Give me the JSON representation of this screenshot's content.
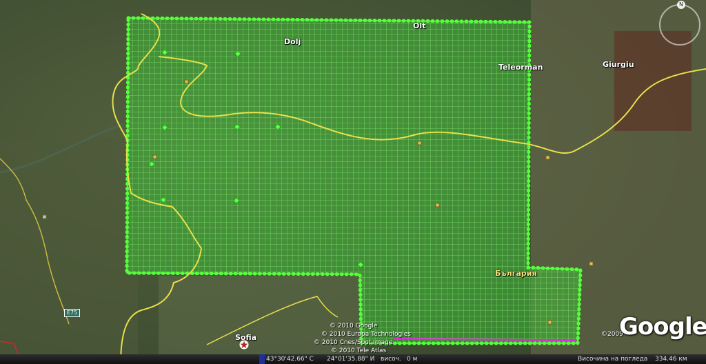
{
  "map": {
    "labels": {
      "dolj": "Dolj",
      "olt": "Olt",
      "teleorman": "Teleorman",
      "giurgiu": "Giurgiu",
      "bulgaria": "България",
      "sofia": "Sofia",
      "e75": "E75"
    },
    "copyrights": {
      "google": "© 2010 Google",
      "europa": "© 2010 Europa Technologies",
      "cnes": "© 2010 Cnes/Spot Image",
      "teleatlas": "© 2010 Tele Atlas",
      "year_right": "©2009"
    },
    "logo": "Google",
    "compass_north": "N"
  },
  "statusbar": {
    "latitude": "43°30'42.66\" С",
    "longitude": "24°01'35.88\" И",
    "elevation_label": "височ.",
    "elevation_value": "0 м",
    "eye_alt_label": "Височина на погледа",
    "eye_alt_value": "334.46 км"
  },
  "colors": {
    "grid_line": "#7dff6a",
    "grid_fill": "#3fd23a",
    "boundary_yellow": "#e8e04a",
    "magenta_line": "#d830d8",
    "border_red": "#cc2a2a"
  }
}
